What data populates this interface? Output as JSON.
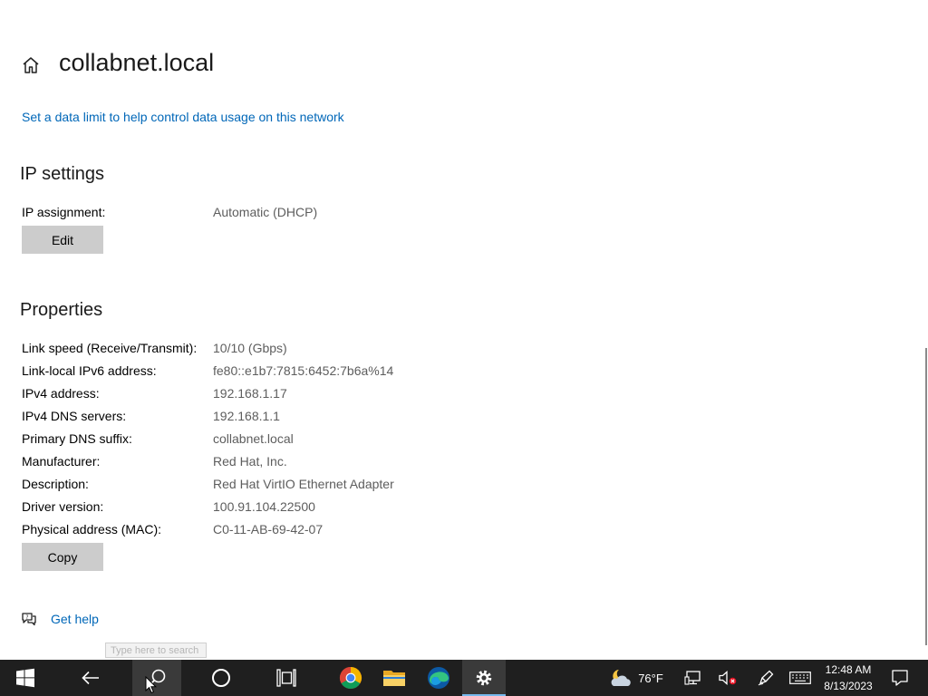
{
  "header": {
    "title": "collabnet.local",
    "home_icon": "home-icon"
  },
  "data_limit_link": "Set a data limit to help control data usage on this network",
  "ip_settings": {
    "heading": "IP settings",
    "assignment_label": "IP assignment:",
    "assignment_value": "Automatic (DHCP)",
    "edit_label": "Edit"
  },
  "properties": {
    "heading": "Properties",
    "rows": [
      {
        "label": "Link speed (Receive/Transmit):",
        "value": "10/10 (Gbps)"
      },
      {
        "label": "Link-local IPv6 address:",
        "value": "fe80::e1b7:7815:6452:7b6a%14"
      },
      {
        "label": "IPv4 address:",
        "value": "192.168.1.17"
      },
      {
        "label": "IPv4 DNS servers:",
        "value": "192.168.1.1"
      },
      {
        "label": "Primary DNS suffix:",
        "value": "collabnet.local"
      },
      {
        "label": "Manufacturer:",
        "value": "Red Hat, Inc."
      },
      {
        "label": "Description:",
        "value": "Red Hat VirtIO Ethernet Adapter"
      },
      {
        "label": "Driver version:",
        "value": "100.91.104.22500"
      },
      {
        "label": "Physical address (MAC):",
        "value": "C0-11-AB-69-42-07"
      }
    ],
    "copy_label": "Copy"
  },
  "help": {
    "label": "Get help"
  },
  "search_tooltip": "Type here to search",
  "taskbar": {
    "weather_temp": "76°F",
    "time": "12:48 AM",
    "date": "8/13/2023",
    "accent_color": "#76b9ed"
  },
  "colors": {
    "link": "#0067b8",
    "button": "#cccccc",
    "taskbar": "#1f1f1f"
  }
}
